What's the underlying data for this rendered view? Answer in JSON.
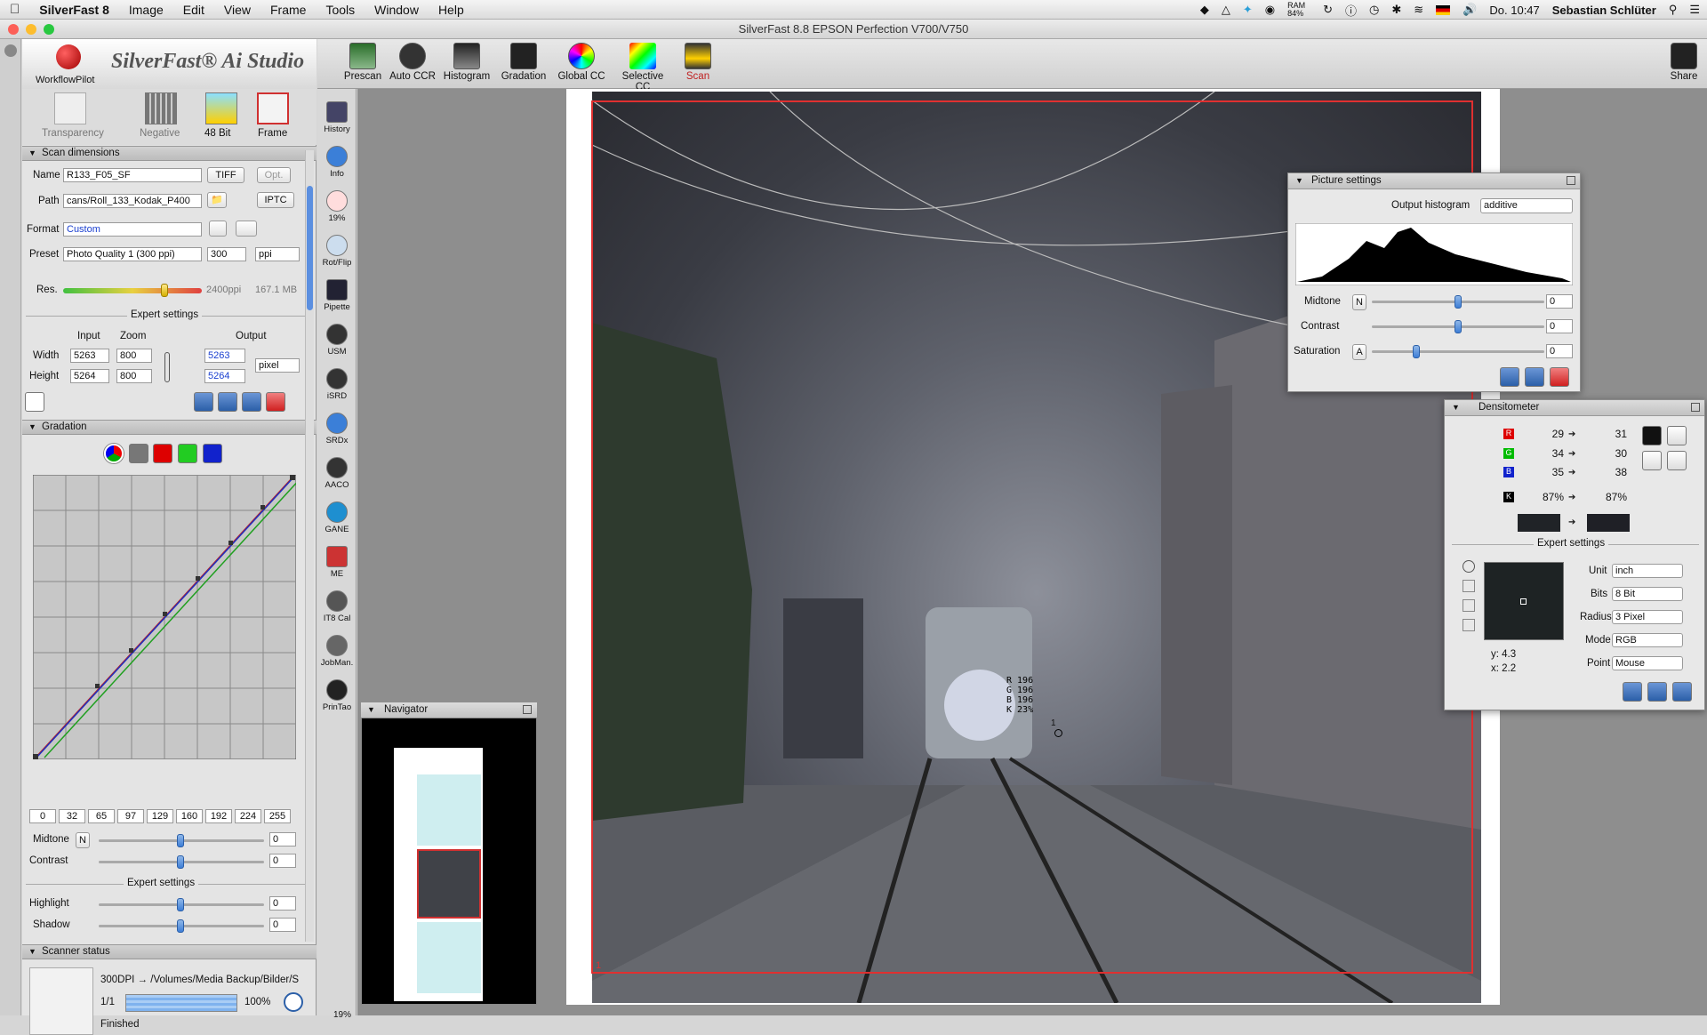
{
  "menubar": {
    "apple": "",
    "app": "SilverFast 8",
    "items": [
      "Image",
      "Edit",
      "View",
      "Frame",
      "Tools",
      "Window",
      "Help"
    ],
    "ram": "RAM 84%",
    "time": "Do. 10:47",
    "user": "Sebastian Schlüter"
  },
  "window": {
    "title": "SilverFast 8.8 EPSON Perfection V700/V750"
  },
  "logo": {
    "brand": "SilverFast® Ai Studio",
    "wp": "WorkflowPilot"
  },
  "modes": [
    "Transparency",
    "Negative",
    "48 Bit",
    "Frame"
  ],
  "scan": {
    "header": "Scan dimensions",
    "name_label": "Name",
    "name": "R133_F05_SF",
    "format_file": "TIFF",
    "opt": "Opt.",
    "path_label": "Path",
    "path": "cans/Roll_133_Kodak_P400",
    "iptc": "IPTC",
    "format_label": "Format",
    "format": "Custom",
    "preset_label": "Preset",
    "preset": "Photo Quality 1 (300 ppi)",
    "ppi": "300",
    "ppi_unit": "ppi",
    "res_label": "Res.",
    "res_value": "2400ppi",
    "size": "167.1 MB",
    "expert": "Expert settings",
    "input": "Input",
    "zoom": "Zoom",
    "output": "Output",
    "width_label": "Width",
    "width_in": "5263",
    "width_zoom": "800",
    "width_out": "5263",
    "height_label": "Height",
    "height_in": "5264",
    "height_zoom": "800",
    "height_out": "5264",
    "unit": "pixel"
  },
  "gradation": {
    "header": "Gradation",
    "ticks": [
      "0",
      "32",
      "65",
      "97",
      "129",
      "160",
      "192",
      "224",
      "255"
    ],
    "midtone_label": "Midtone",
    "midtone_mode": "N",
    "midtone": "0",
    "contrast_label": "Contrast",
    "contrast": "0",
    "expert": "Expert settings",
    "highlight_label": "Highlight",
    "highlight": "0",
    "shadow_label": "Shadow",
    "shadow": "0"
  },
  "status": {
    "header": "Scanner status",
    "line1": "300DPI → /Volumes/Media Backup/Bilder/S",
    "count": "1/1",
    "pct": "100%",
    "state": "Finished",
    "progress": 1.0
  },
  "toolbar": [
    "Prescan",
    "Auto CCR",
    "Histogram",
    "Gradation",
    "Global CC",
    "Selective CC",
    "Scan"
  ],
  "share": "Share",
  "vtools": [
    "History",
    "Info",
    "19%",
    "Rot/Flip",
    "Pipette",
    "USM",
    "iSRD",
    "SRDx",
    "AACO",
    "GANE",
    "ME",
    "IT8 Cal",
    "JobMan.",
    "PrinTao"
  ],
  "navigator": {
    "title": "Navigator"
  },
  "zoom_footer": "19%",
  "readout": {
    "r": "R 196",
    "g": "G 196",
    "b": "B 196",
    "k": "K 23%",
    "marker": "1"
  },
  "frame_label": "1",
  "picture": {
    "title": "Picture settings",
    "output_label": "Output histogram",
    "output_mode": "additive",
    "midtone_label": "Midtone",
    "midtone_mode": "N",
    "midtone": "0",
    "contrast_label": "Contrast",
    "contrast": "0",
    "saturation_label": "Saturation",
    "saturation_mode": "A",
    "saturation": "0"
  },
  "densito": {
    "title": "Densitometer",
    "r_in": "29",
    "r_out": "31",
    "g_in": "34",
    "g_out": "30",
    "b_in": "35",
    "b_out": "38",
    "k_in": "87%",
    "k_out": "87%",
    "expert": "Expert settings",
    "unit_label": "Unit",
    "unit": "inch",
    "bits_label": "Bits",
    "bits": "8 Bit",
    "radius_label": "Radius",
    "radius": "3 Pixel",
    "mode_label": "Mode",
    "mode": "RGB",
    "point_label": "Point",
    "point": "Mouse",
    "y": "y: 4.3",
    "x": "x: 2.2"
  },
  "colors": {
    "accent": "#3d7ed6",
    "frame": "#e03030"
  }
}
